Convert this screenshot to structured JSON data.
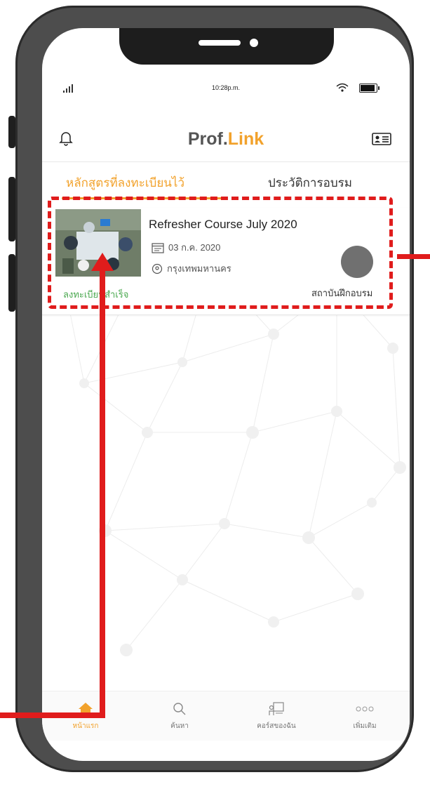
{
  "status_bar": {
    "time": "10:28p.m."
  },
  "header": {
    "brand_main": "Prof.",
    "brand_accent": "Link"
  },
  "tabs": [
    {
      "label": "หลักสูตรที่ลงทะเบียนไว้",
      "active": true
    },
    {
      "label": "ประวัติการอบรม",
      "active": false
    }
  ],
  "course": {
    "title": "Refresher Course July 2020",
    "date": "03 ก.ค. 2020",
    "location": "กรุงเทพมหานคร",
    "status": "ลงทะเบียนสำเร็จ",
    "institute": "สถาบันฝึกอบรม"
  },
  "bottom_nav": [
    {
      "label": "หน้าแรก",
      "icon": "home-icon",
      "active": true
    },
    {
      "label": "ค้นหา",
      "icon": "search-icon",
      "active": false
    },
    {
      "label": "คอร์สของฉัน",
      "icon": "my-courses-icon",
      "active": false
    },
    {
      "label": "เพิ่มเติม",
      "icon": "more-icon",
      "active": false
    }
  ],
  "colors": {
    "accent": "#f2a22c",
    "success": "#4aa84f",
    "annotation": "#e01c1c"
  }
}
